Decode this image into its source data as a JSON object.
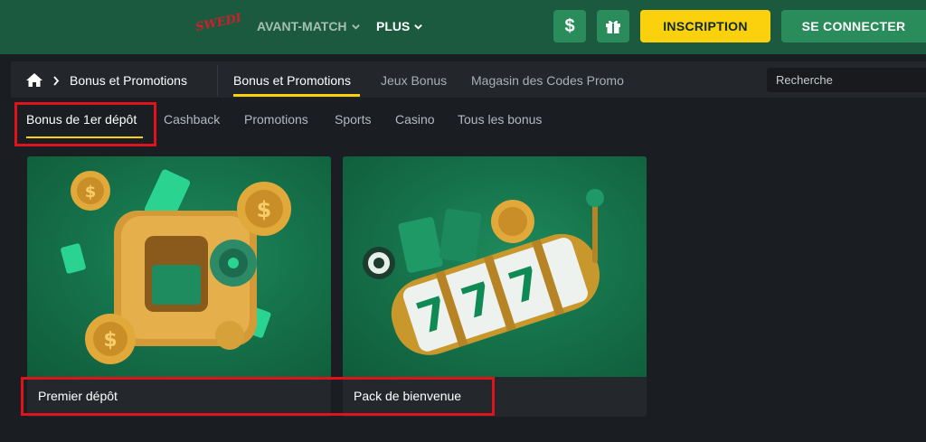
{
  "header": {
    "logo_text": "SWEDI",
    "nav": {
      "avant_match": "AVANT-MATCH",
      "plus": "PLUS"
    },
    "dollar_icon_text": "$",
    "inscription": "INSCRIPTION",
    "connect": "SE CONNECTER"
  },
  "breadcrumb": {
    "current": "Bonus et Promotions"
  },
  "section_tabs": [
    {
      "label": "Bonus et Promotions",
      "active": true
    },
    {
      "label": "Jeux Bonus",
      "active": false
    },
    {
      "label": "Magasin des Codes Promo",
      "active": false
    }
  ],
  "search": {
    "placeholder": "Recherche"
  },
  "category_tabs": [
    {
      "label": "Bonus de 1er dépôt",
      "active": true
    },
    {
      "label": "Cashback",
      "active": false
    },
    {
      "label": "Promotions",
      "active": false
    },
    {
      "label": "Sports",
      "active": false
    },
    {
      "label": "Casino",
      "active": false
    },
    {
      "label": "Tous les bonus",
      "active": false
    }
  ],
  "cards": [
    {
      "title": "Premier dépôt",
      "image": "safe-with-coins"
    },
    {
      "title": "Pack de bienvenue",
      "image": "slot-machine-777"
    }
  ],
  "colors": {
    "header_bg": "#1b5a3f",
    "accent_yellow": "#fbd10d",
    "button_green": "#2a8c5b",
    "highlight_red": "#e0121b",
    "page_bg": "#1a1d21"
  }
}
